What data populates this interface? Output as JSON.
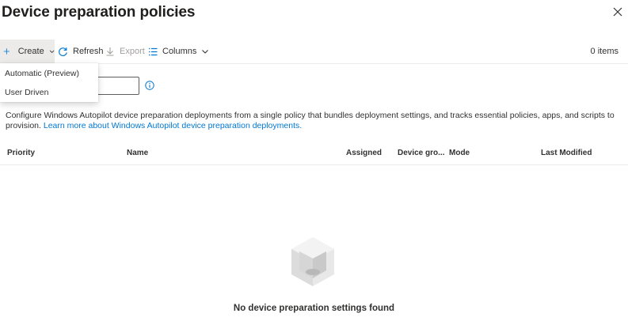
{
  "header": {
    "title": "Device preparation policies",
    "more_label": "···"
  },
  "toolbar": {
    "create_label": "Create",
    "refresh_label": "Refresh",
    "export_label": "Export",
    "columns_label": "Columns",
    "count_label": "0 items"
  },
  "create_menu": {
    "items": [
      "Automatic (Preview)",
      "User Driven"
    ]
  },
  "description": {
    "text": "Configure Windows Autopilot device preparation deployments from a single policy that bundles deployment settings, and tracks essential policies, apps, and scripts to provision.",
    "link_text": "Learn more about Windows Autopilot device preparation deployments."
  },
  "table": {
    "columns": [
      "Priority",
      "Name",
      "Assigned",
      "Device gro...",
      "Mode",
      "Last Modified"
    ]
  },
  "empty_state": {
    "message": "No device preparation settings found"
  },
  "colors": {
    "accent": "#0078d4",
    "selected_bg": "#edebe9",
    "text": "#323130"
  }
}
